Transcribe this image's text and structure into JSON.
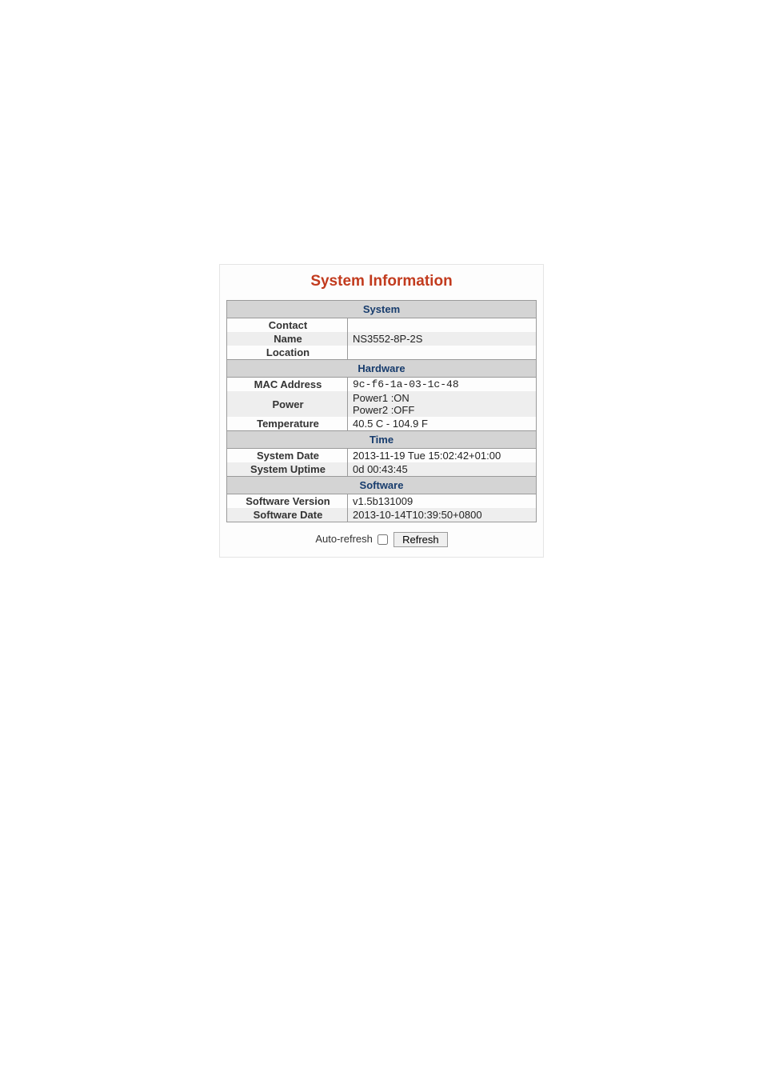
{
  "title": "System Information",
  "sections": {
    "system": {
      "header": "System",
      "contact_label": "Contact",
      "contact_value": "",
      "name_label": "Name",
      "name_value": "NS3552-8P-2S",
      "location_label": "Location",
      "location_value": ""
    },
    "hardware": {
      "header": "Hardware",
      "mac_label": "MAC Address",
      "mac_value": "9c-f6-1a-03-1c-48",
      "power_label": "Power",
      "power_line1": "Power1 :ON",
      "power_line2": "Power2 :OFF",
      "temp_label": "Temperature",
      "temp_value": "40.5 C - 104.9 F"
    },
    "time": {
      "header": "Time",
      "date_label": "System Date",
      "date_value": "2013-11-19 Tue 15:02:42+01:00",
      "uptime_label": "System Uptime",
      "uptime_value": "0d 00:43:45"
    },
    "software": {
      "header": "Software",
      "version_label": "Software Version",
      "version_value": "v1.5b131009",
      "swdate_label": "Software Date",
      "swdate_value": "2013-10-14T10:39:50+0800"
    }
  },
  "controls": {
    "auto_refresh_label": "Auto-refresh",
    "refresh_button": "Refresh"
  }
}
